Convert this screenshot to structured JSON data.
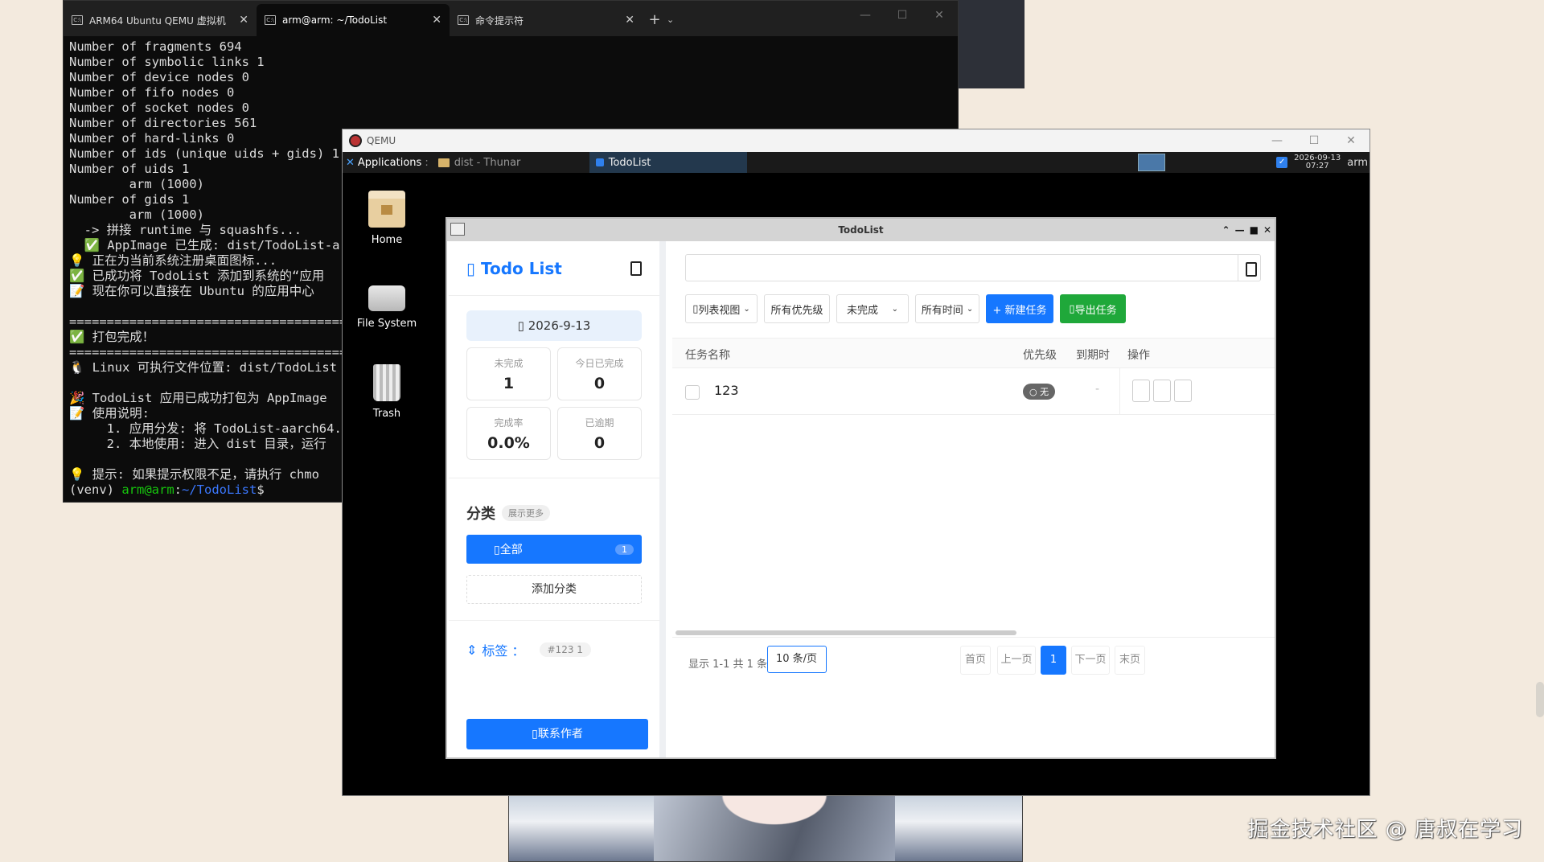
{
  "terminal": {
    "tabs": [
      {
        "label": "ARM64 Ubuntu QEMU 虚拟机"
      },
      {
        "label": "arm@arm: ~/TodoList"
      },
      {
        "label": "命令提示符"
      }
    ],
    "lines": [
      "Number of fragments 694",
      "Number of symbolic links 1",
      "Number of device nodes 0",
      "Number of fifo nodes 0",
      "Number of socket nodes 0",
      "Number of directories 561",
      "Number of hard-links 0",
      "Number of ids (unique uids + gids) 1",
      "Number of uids 1",
      "        arm (1000)",
      "Number of gids 1",
      "        arm (1000)",
      "  -> 拼接 runtime 与 squashfs...",
      "  ✅ AppImage 已生成: dist/TodoList-a",
      "💡 正在为当前系统注册桌面图标...",
      "✅ 已成功将 TodoList 添加到系统的“应用",
      "📝 现在你可以直接在 Ubuntu 的应用中心",
      "",
      "============================================",
      "✅ 打包完成！",
      "============================================",
      "🐧 Linux 可执行文件位置: dist/TodoList",
      "",
      "🎉 TodoList 应用已成功打包为 AppImage",
      "📝 使用说明:",
      "     1. 应用分发: 将 TodoList-aarch64.",
      "     2. 本地使用: 进入 dist 目录，运行",
      "",
      "💡 提示: 如果提示权限不足，请执行 chmo"
    ],
    "prompt": {
      "venv": "(venv) ",
      "user": "arm@arm",
      "sep": ":",
      "path": "~/TodoList",
      "end": "$"
    }
  },
  "qemu": {
    "title": "QEMU",
    "panel": {
      "applications": "Applications",
      "tasks": [
        {
          "label": "dist - Thunar"
        },
        {
          "label": "TodoList"
        }
      ],
      "clock_date": "2026-09-13",
      "clock_time": "07:27",
      "user": "arm"
    },
    "desktop_icons": [
      {
        "label": "Home"
      },
      {
        "label": "File System"
      },
      {
        "label": "Trash"
      }
    ]
  },
  "todo": {
    "window_title": "TodoList",
    "brand": "Todo List",
    "date": "2026-9-13",
    "stats": [
      {
        "label": "未完成",
        "value": "1"
      },
      {
        "label": "今日已完成",
        "value": "0"
      },
      {
        "label": "完成率",
        "value": "0.0%"
      },
      {
        "label": "已逾期",
        "value": "0"
      }
    ],
    "categories_title": "分类",
    "show_more": "展示更多",
    "category_all": {
      "label": "全部",
      "count": "1"
    },
    "add_category": "添加分类",
    "tags_label": "标签 ：",
    "tag_chip": "#123  1",
    "contact": "联系作者",
    "toolbar": {
      "view": "列表视图",
      "priority": "所有优先级",
      "status": "未完成",
      "time": "所有时间",
      "new_task": "+ 新建任务",
      "export": "导出任务"
    },
    "columns": {
      "name": "任务名称",
      "priority": "优先级",
      "due": "到期时",
      "actions": "操作"
    },
    "rows": [
      {
        "name": "123",
        "priority": "○ 无",
        "due": "-"
      }
    ],
    "footer": {
      "info": "显示 1-1 共 1 条",
      "page_size": "10 条/页",
      "first": "首页",
      "prev": "上一页",
      "current": "1",
      "next": "下一页",
      "last": "末页"
    }
  },
  "watermark": "掘金技术社区 @ 唐叔在学习",
  "colors": {
    "accent": "#1677ff",
    "success": "#1fa83a",
    "terminal_green": "#16c60c",
    "terminal_blue": "#3b78ff"
  }
}
